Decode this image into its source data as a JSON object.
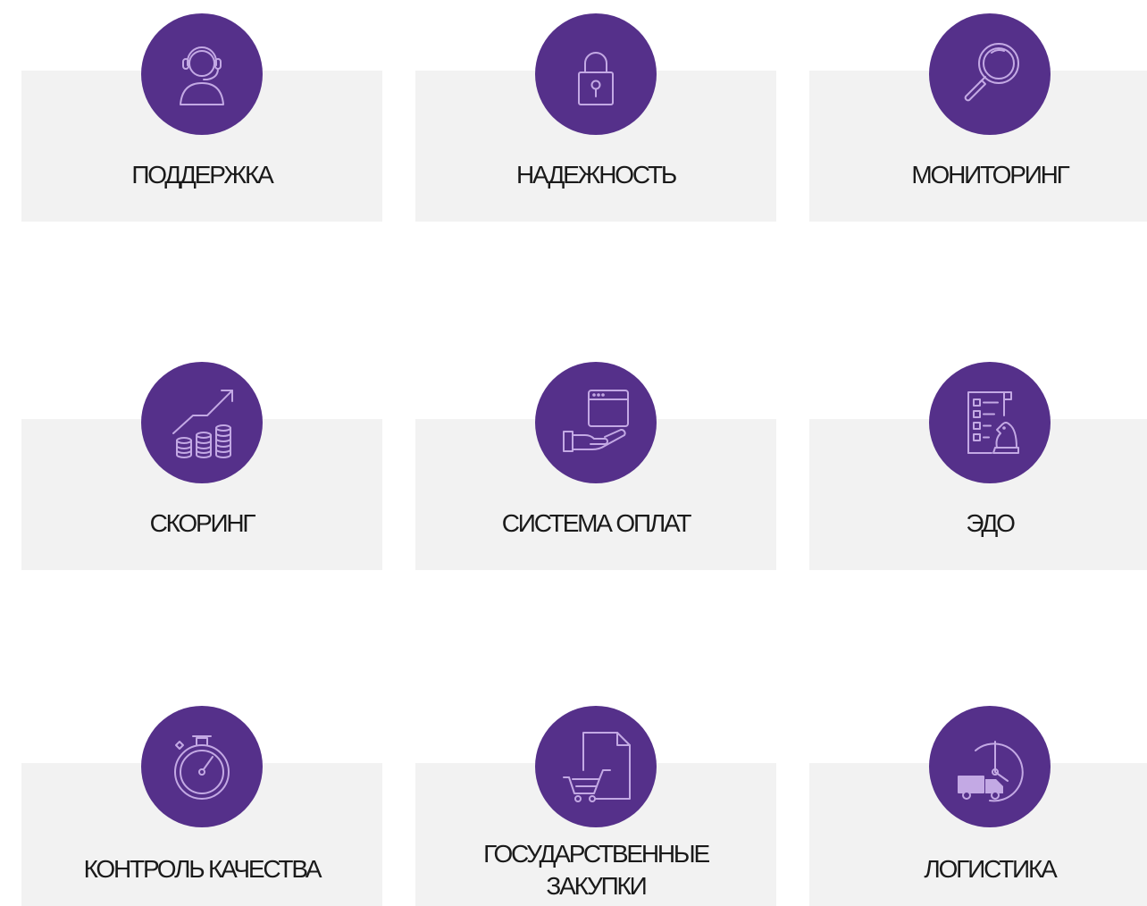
{
  "colors": {
    "accent": "#55308a",
    "icon_stroke": "#c3a9e4",
    "card_bg": "#f2f2f2",
    "text": "#1a1a1a"
  },
  "features": [
    {
      "label": "ПОДДЕРЖКА",
      "icon": "headset-operator-icon"
    },
    {
      "label": "НАДЕЖНОСТЬ",
      "icon": "padlock-icon"
    },
    {
      "label": "МОНИТОРИНГ",
      "icon": "magnifier-icon"
    },
    {
      "label": "СКОРИНГ",
      "icon": "growth-chart-coins-icon"
    },
    {
      "label": "СИСТЕМА ОПЛАТ",
      "icon": "hand-browser-window-icon"
    },
    {
      "label": "ЭДО",
      "icon": "document-chess-knight-icon"
    },
    {
      "label": "КОНТРОЛЬ КАЧЕСТВА",
      "icon": "stopwatch-icon"
    },
    {
      "label": "ГОСУДАРСТВЕННЫЕ ЗАКУПКИ",
      "label_line1": "ГОСУДАРСТВЕННЫЕ",
      "label_line2": "ЗАКУПКИ",
      "icon": "document-shopping-cart-icon"
    },
    {
      "label": "ЛОГИСТИКА",
      "icon": "truck-clock-icon"
    }
  ]
}
